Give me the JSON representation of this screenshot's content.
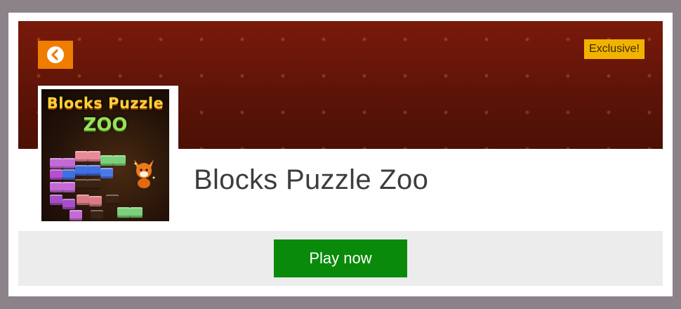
{
  "game": {
    "title": "Blocks Puzzle Zoo",
    "badge": "Exclusive!",
    "thumbnail_title_line1": "Blocks Puzzle",
    "thumbnail_title_line2": "ZOO"
  },
  "actions": {
    "back_icon": "chevron-left-circle-icon",
    "play_label": "Play now"
  },
  "colors": {
    "banner": "#6a170a",
    "back_button": "#ef7d00",
    "badge": "#f2b300",
    "play_button": "#0a8a0a",
    "play_bar": "#ececec"
  }
}
